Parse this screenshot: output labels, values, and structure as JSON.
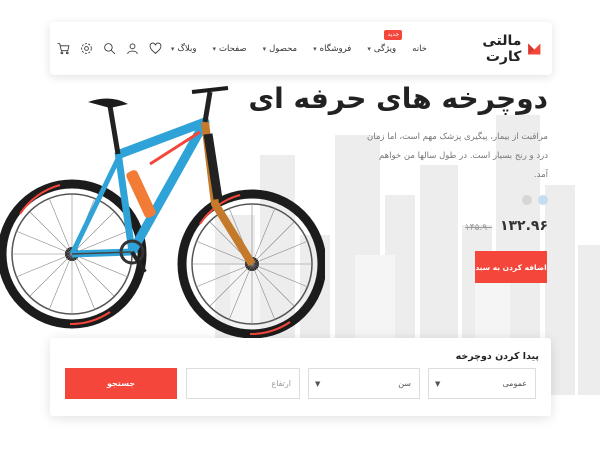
{
  "brand": {
    "name": "مالتی کارت",
    "accent": "#f4463a"
  },
  "nav": {
    "items": [
      {
        "label": "خانه",
        "dropdown": false
      },
      {
        "label": "ویژگی",
        "dropdown": true,
        "badge": "جدید"
      },
      {
        "label": "فروشگاه",
        "dropdown": true
      },
      {
        "label": "محصول",
        "dropdown": true
      },
      {
        "label": "صفحات",
        "dropdown": true
      },
      {
        "label": "وبلاگ",
        "dropdown": true
      }
    ],
    "icons": [
      "heart-icon",
      "user-icon",
      "search-icon",
      "settings-icon",
      "cart-icon"
    ]
  },
  "hero": {
    "title": "دوچرخه های حرفه ای",
    "description": "مراقبت از بیمار، پیگیری پزشک مهم است، اما زمان درد و رنج بسیار است. در طول سالها من خواهم آمد.",
    "swatches": [
      "#c6dcf0",
      "#d6d6d6"
    ],
    "price_new": "۱۳۲.۹۶",
    "price_old": "۱۴۵.۹۰",
    "add_to_cart": "اضافه کردن به سبد"
  },
  "search": {
    "title": "پیدا کردن دوچرخه",
    "category_value": "عمومی",
    "age_value": "سن",
    "height_placeholder": "ارتفاع",
    "button": "جستجو"
  }
}
